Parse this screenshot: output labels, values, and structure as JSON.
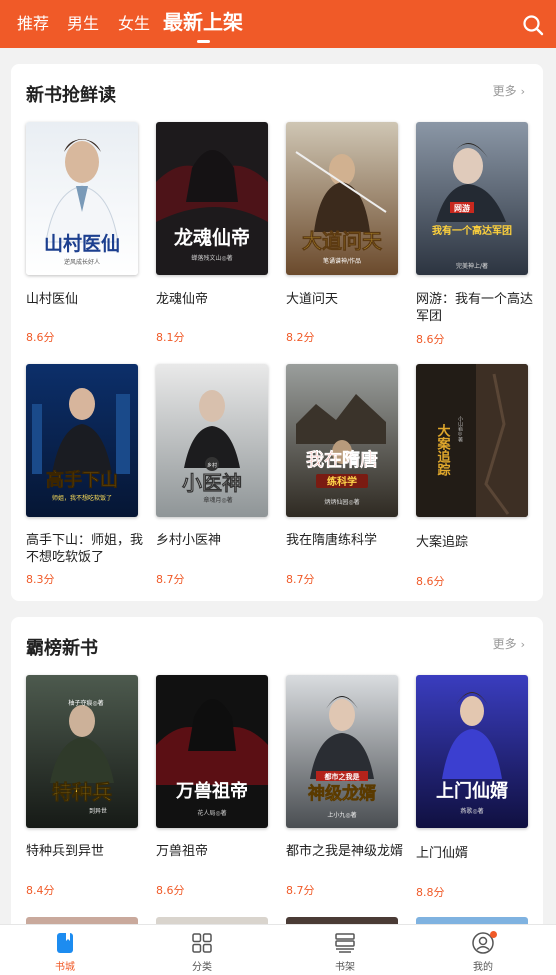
{
  "header": {
    "tabs": [
      {
        "label": "推荐"
      },
      {
        "label": "男生"
      },
      {
        "label": "女生"
      },
      {
        "label": "最新上架"
      }
    ],
    "search_icon": "search-icon",
    "bg_color": "#f05a28"
  },
  "sections": [
    {
      "title": "新书抢鲜读",
      "more": "更多",
      "books": [
        {
          "title": "山村医仙",
          "score": "8.6分",
          "cover_text": "山村医仙",
          "cover_sub": "逆风成长好人"
        },
        {
          "title": "龙魂仙帝",
          "score": "8.1分",
          "cover_text": "龙魂仙帝",
          "cover_sub": "蝉落残文山◎著"
        },
        {
          "title": "大道问天",
          "score": "8.2分",
          "cover_text": "大道问天",
          "cover_sub": "笔诵谱神/作品"
        },
        {
          "title": "网游：我有一个高达军团",
          "score": "8.6分",
          "cover_text": "我有一个高达军团",
          "cover_sub": "完美神上/著",
          "cover_badge": "网游"
        },
        {
          "title": "高手下山：师姐，我不想吃软饭了",
          "score": "8.3分",
          "cover_text": "高手下山",
          "cover_sub": "师姐，我不想吃软饭了"
        },
        {
          "title": "乡村小医神",
          "score": "8.7分",
          "cover_text": "小医神",
          "cover_sub": "章魂月◎著",
          "cover_badge": "乡村"
        },
        {
          "title": "我在隋唐练科学",
          "score": "8.7分",
          "cover_text": "我在隋唐",
          "cover_sub": "练科学",
          "cover_author": "炳炳仙园◎著"
        },
        {
          "title": "大案追踪",
          "score": "8.6分",
          "cover_text": "大案追踪",
          "cover_sub": "小山岩◎著"
        }
      ]
    },
    {
      "title": "霸榜新书",
      "more": "更多",
      "books": [
        {
          "title": "特种兵到异世",
          "score": "8.4分",
          "cover_text": "特种兵",
          "cover_sub": "到异世",
          "cover_author": "柚子夺痕◎著"
        },
        {
          "title": "万兽祖帝",
          "score": "8.6分",
          "cover_text": "万兽祖帝",
          "cover_sub": "花人局◎著"
        },
        {
          "title": "都市之我是神级龙婿",
          "score": "8.7分",
          "cover_text": "神级龙婿",
          "cover_sub": "都市之我是",
          "cover_author": "上小九◎著"
        },
        {
          "title": "上门仙婿",
          "score": "8.8分",
          "cover_text": "上门仙婿",
          "cover_sub": "燕歌◎著"
        }
      ]
    }
  ],
  "bottom_nav": [
    {
      "label": "书城",
      "icon": "book-city-icon"
    },
    {
      "label": "分类",
      "icon": "category-grid-icon"
    },
    {
      "label": "书架",
      "icon": "bookshelf-icon"
    },
    {
      "label": "我的",
      "icon": "profile-icon"
    }
  ],
  "colors": {
    "accent": "#f05a28",
    "score": "#f05a28",
    "background": "#f2f2f2"
  }
}
